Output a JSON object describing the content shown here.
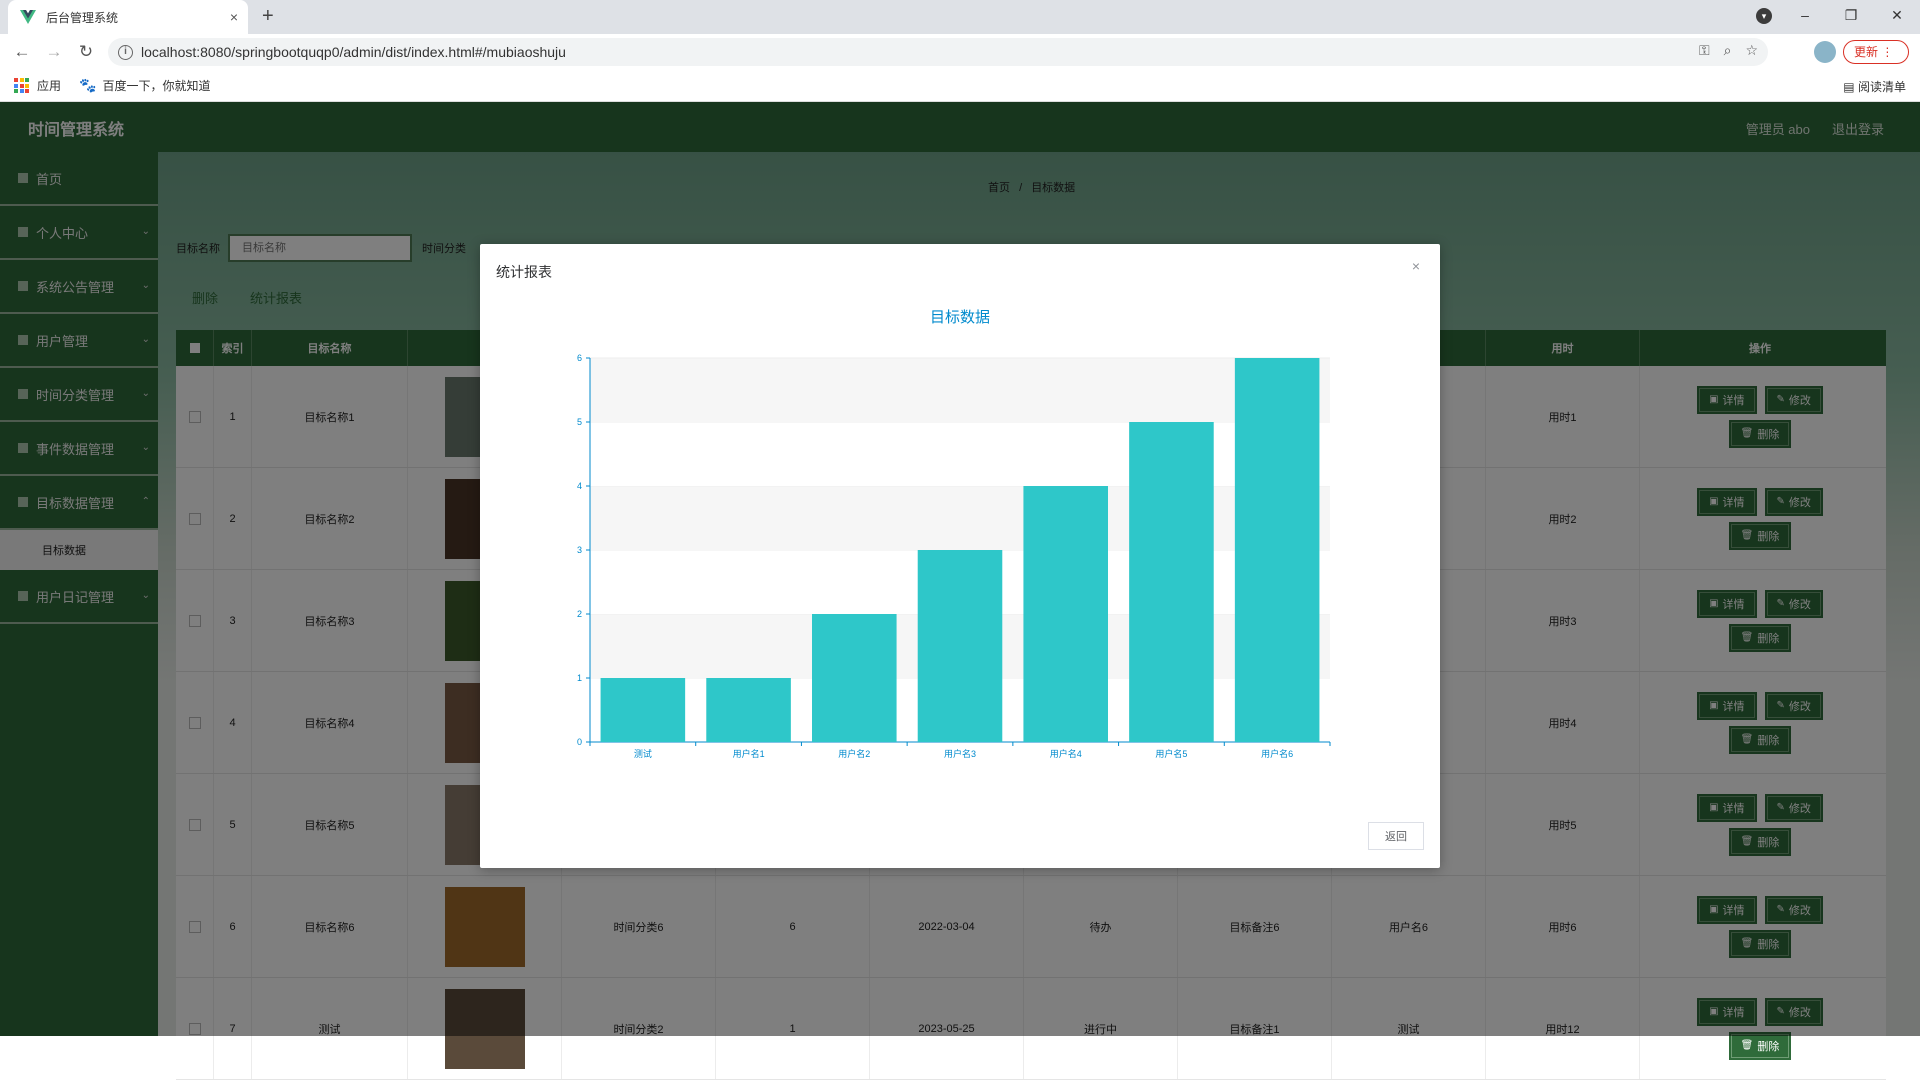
{
  "browser": {
    "tab_title": "后台管理系统",
    "tab_close": "×",
    "new_tab": "+",
    "url": "localhost:8080/springbootquqp0/admin/dist/index.html#/mubiaoshuju",
    "update_label": "更新",
    "bookmarks": [
      "应用",
      "百度一下，你就知道"
    ],
    "reading_list": "阅读清单",
    "window_controls": [
      "–",
      "❐",
      "✕"
    ]
  },
  "header": {
    "title": "时间管理系统",
    "admin": "管理员 abo",
    "logout": "退出登录"
  },
  "sidebar": {
    "items": [
      {
        "label": "首页"
      },
      {
        "label": "个人中心"
      },
      {
        "label": "系统公告管理"
      },
      {
        "label": "用户管理"
      },
      {
        "label": "时间分类管理"
      },
      {
        "label": "事件数据管理"
      },
      {
        "label": "目标数据管理"
      },
      {
        "label": "用户日记管理"
      }
    ],
    "sub_item": "目标数据"
  },
  "breadcrumb": {
    "home": "首页",
    "sep": "/",
    "current": "目标数据"
  },
  "search": {
    "target_name_label": "目标名称",
    "target_name_placeholder": "目标名称",
    "time_category_label": "时间分类"
  },
  "actions": {
    "delete": "删除",
    "report": "统计报表"
  },
  "table": {
    "headers": [
      "索引",
      "目标名称",
      "用时",
      "操作"
    ],
    "rows": [
      {
        "index": "1",
        "name": "目标名称1",
        "category": "",
        "num": "",
        "date": "",
        "status": "",
        "note": "",
        "user": "",
        "time": "用时1"
      },
      {
        "index": "2",
        "name": "目标名称2",
        "category": "",
        "num": "",
        "date": "",
        "status": "",
        "note": "",
        "user": "",
        "time": "用时2"
      },
      {
        "index": "3",
        "name": "目标名称3",
        "category": "",
        "num": "",
        "date": "",
        "status": "",
        "note": "",
        "user": "",
        "time": "用时3"
      },
      {
        "index": "4",
        "name": "目标名称4",
        "category": "",
        "num": "",
        "date": "",
        "status": "",
        "note": "",
        "user": "",
        "time": "用时4"
      },
      {
        "index": "5",
        "name": "目标名称5",
        "category": "",
        "num": "",
        "date": "",
        "status": "",
        "note": "",
        "user": "",
        "time": "用时5"
      },
      {
        "index": "6",
        "name": "目标名称6",
        "category": "时间分类6",
        "num": "6",
        "date": "2022-03-04",
        "status": "待办",
        "note": "目标备注6",
        "user": "用户名6",
        "time": "用时6"
      },
      {
        "index": "7",
        "name": "测试",
        "category": "时间分类2",
        "num": "1",
        "date": "2023-05-25",
        "status": "进行中",
        "note": "目标备注1",
        "user": "测试",
        "time": "用时12"
      }
    ],
    "op_labels": {
      "detail": "详情",
      "edit": "修改",
      "delete": "删除"
    }
  },
  "thumb_colors": [
    "#6b7a6e",
    "#4a3526",
    "#3d5a2a",
    "#7a5a44",
    "#8a7a6a",
    "#a06a2a",
    "#5a4a3a"
  ],
  "modal": {
    "title": "统计报表",
    "close": "×",
    "return_label": "返回"
  },
  "chart_data": {
    "type": "bar",
    "title": "目标数据",
    "categories": [
      "测试",
      "用户名1",
      "用户名2",
      "用户名3",
      "用户名4",
      "用户名5",
      "用户名6"
    ],
    "values": [
      1,
      1,
      2,
      3,
      4,
      5,
      6
    ],
    "ylim": [
      0,
      6
    ],
    "yticks": [
      0,
      1,
      2,
      3,
      4,
      5,
      6
    ],
    "bar_color": "#2ec7c9",
    "axis_color": "#008acd",
    "title_color": "#008acd",
    "grid": "banded"
  }
}
